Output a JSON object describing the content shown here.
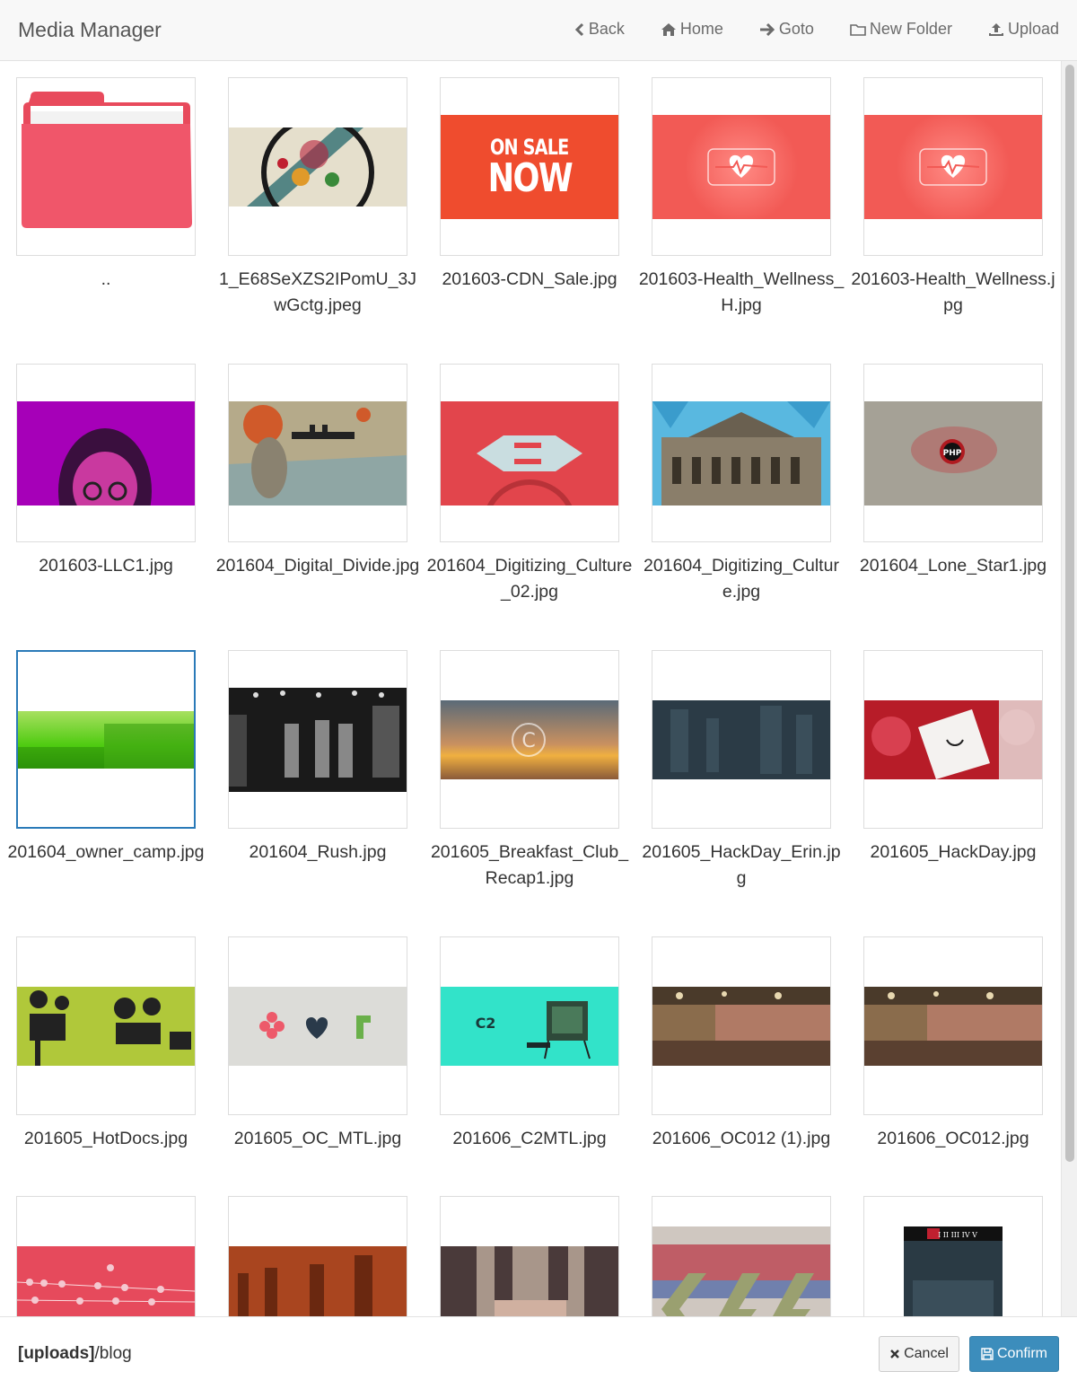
{
  "header": {
    "title": "Media Manager",
    "nav": [
      {
        "label": "Back",
        "icon": "chevron-left-icon"
      },
      {
        "label": "Home",
        "icon": "home-icon"
      },
      {
        "label": "Goto",
        "icon": "arrow-right-icon"
      },
      {
        "label": "New Folder",
        "icon": "folder-icon"
      },
      {
        "label": "Upload",
        "icon": "upload-icon"
      }
    ]
  },
  "files": [
    {
      "name": "..",
      "kind": "folder"
    },
    {
      "name": "1_E68SeXZS2IPomU_3JwGctg.jpeg",
      "kind": "image",
      "thumb": "abstract"
    },
    {
      "name": "201603-CDN_Sale.jpg",
      "kind": "image",
      "thumb": "sale",
      "text": "ON SALE NOW"
    },
    {
      "name": "201603-Health_Wellness_H.jpg",
      "kind": "image",
      "thumb": "health"
    },
    {
      "name": "201603-Health_Wellness.jpg",
      "kind": "image",
      "thumb": "health"
    },
    {
      "name": "201603-LLC1.jpg",
      "kind": "image",
      "thumb": "purple"
    },
    {
      "name": "201604_Digital_Divide.jpg",
      "kind": "image",
      "thumb": "map"
    },
    {
      "name": "201604_Digitizing_Culture_02.jpg",
      "kind": "image",
      "thumb": "plug"
    },
    {
      "name": "201604_Digitizing_Culture.jpg",
      "kind": "image",
      "thumb": "opera"
    },
    {
      "name": "201604_Lone_Star1.jpg",
      "kind": "image",
      "thumb": "php",
      "text": "PHP"
    },
    {
      "name": "201604_owner_camp.jpg",
      "kind": "image",
      "thumb": "green",
      "selected": true
    },
    {
      "name": "201604_Rush.jpg",
      "kind": "image",
      "thumb": "concert"
    },
    {
      "name": "201605_Breakfast_Club_Recap1.jpg",
      "kind": "image",
      "thumb": "sunset"
    },
    {
      "name": "201605_HackDay_Erin.jpg",
      "kind": "image",
      "thumb": "dark"
    },
    {
      "name": "201605_HackDay.jpg",
      "kind": "image",
      "thumb": "redcard"
    },
    {
      "name": "201605_HotDocs.jpg",
      "kind": "image",
      "thumb": "hotdocs"
    },
    {
      "name": "201605_OC_MTL.jpg",
      "kind": "image",
      "thumb": "ocmtl"
    },
    {
      "name": "201606_C2MTL.jpg",
      "kind": "image",
      "thumb": "c2mtl",
      "text": "C2"
    },
    {
      "name": "201606_OC012 (1).jpg",
      "kind": "image",
      "thumb": "hall"
    },
    {
      "name": "201606_OC012.jpg",
      "kind": "image",
      "thumb": "hall"
    },
    {
      "name": "",
      "kind": "image",
      "thumb": "birds"
    },
    {
      "name": "",
      "kind": "image",
      "thumb": "sepia"
    },
    {
      "name": "",
      "kind": "image",
      "thumb": "city"
    },
    {
      "name": "",
      "kind": "image",
      "thumb": "css"
    },
    {
      "name": "",
      "kind": "image",
      "thumb": "phone",
      "text": "I II III IV V"
    }
  ],
  "footer": {
    "path_root": "[uploads]",
    "path_rest": "/blog",
    "cancel_label": "Cancel",
    "confirm_label": "Confirm"
  },
  "colors": {
    "folder": "#f0566a",
    "sale": "#ef4c2e",
    "health": "#f25a55",
    "confirm": "#3c8dbc",
    "selected_border": "#2a7ab8"
  }
}
